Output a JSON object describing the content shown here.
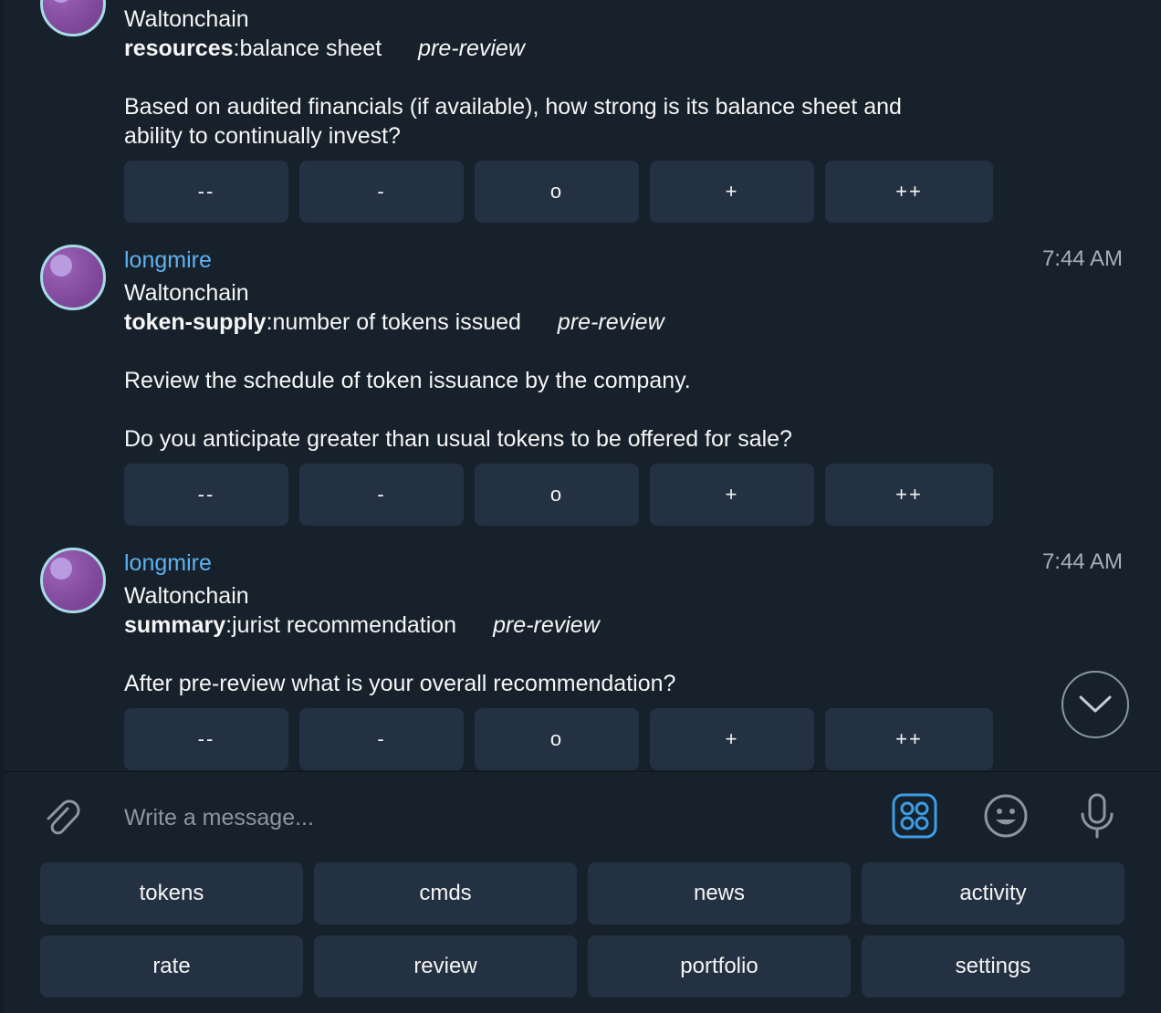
{
  "messages": [
    {
      "project": "Waltonchain",
      "category": "resources",
      "subject": "balance sheet",
      "stage": "pre-review",
      "paragraphs": [
        "Based on audited financials (if available), how strong is its balance sheet and",
        "ability to continually invest?"
      ]
    },
    {
      "author": "longmire",
      "time": "7:44 AM",
      "project": "Waltonchain",
      "category": "token-supply",
      "subject": "number of tokens issued",
      "stage": "pre-review",
      "paragraphs": [
        "Review the schedule of token issuance by the company.",
        "Do you anticipate greater than usual tokens to be offered for sale?"
      ]
    },
    {
      "author": "longmire",
      "time": "7:44 AM",
      "project": "Waltonchain",
      "category": "summary",
      "subject": "jurist recommendation",
      "stage": "pre-review",
      "paragraphs": [
        "After pre-review what is your overall recommendation?"
      ]
    }
  ],
  "vote_buttons": [
    "--",
    "-",
    "o",
    "+",
    "++"
  ],
  "separator": ":",
  "composer": {
    "placeholder": "Write a message..."
  },
  "keyboard": {
    "row1": [
      "tokens",
      "cmds",
      "news",
      "activity"
    ],
    "row2": [
      "rate",
      "review",
      "portfolio",
      "settings"
    ]
  },
  "icons": {
    "attach": "paperclip-icon",
    "bot_keyboard": "bot-keyboard-icon",
    "emoji": "emoji-icon",
    "voice": "microphone-icon",
    "scroll": "chevron-down-icon"
  },
  "colors": {
    "background": "#17212b",
    "button": "#243142",
    "author": "#5fb1ef",
    "accent": "#3d9de5"
  }
}
